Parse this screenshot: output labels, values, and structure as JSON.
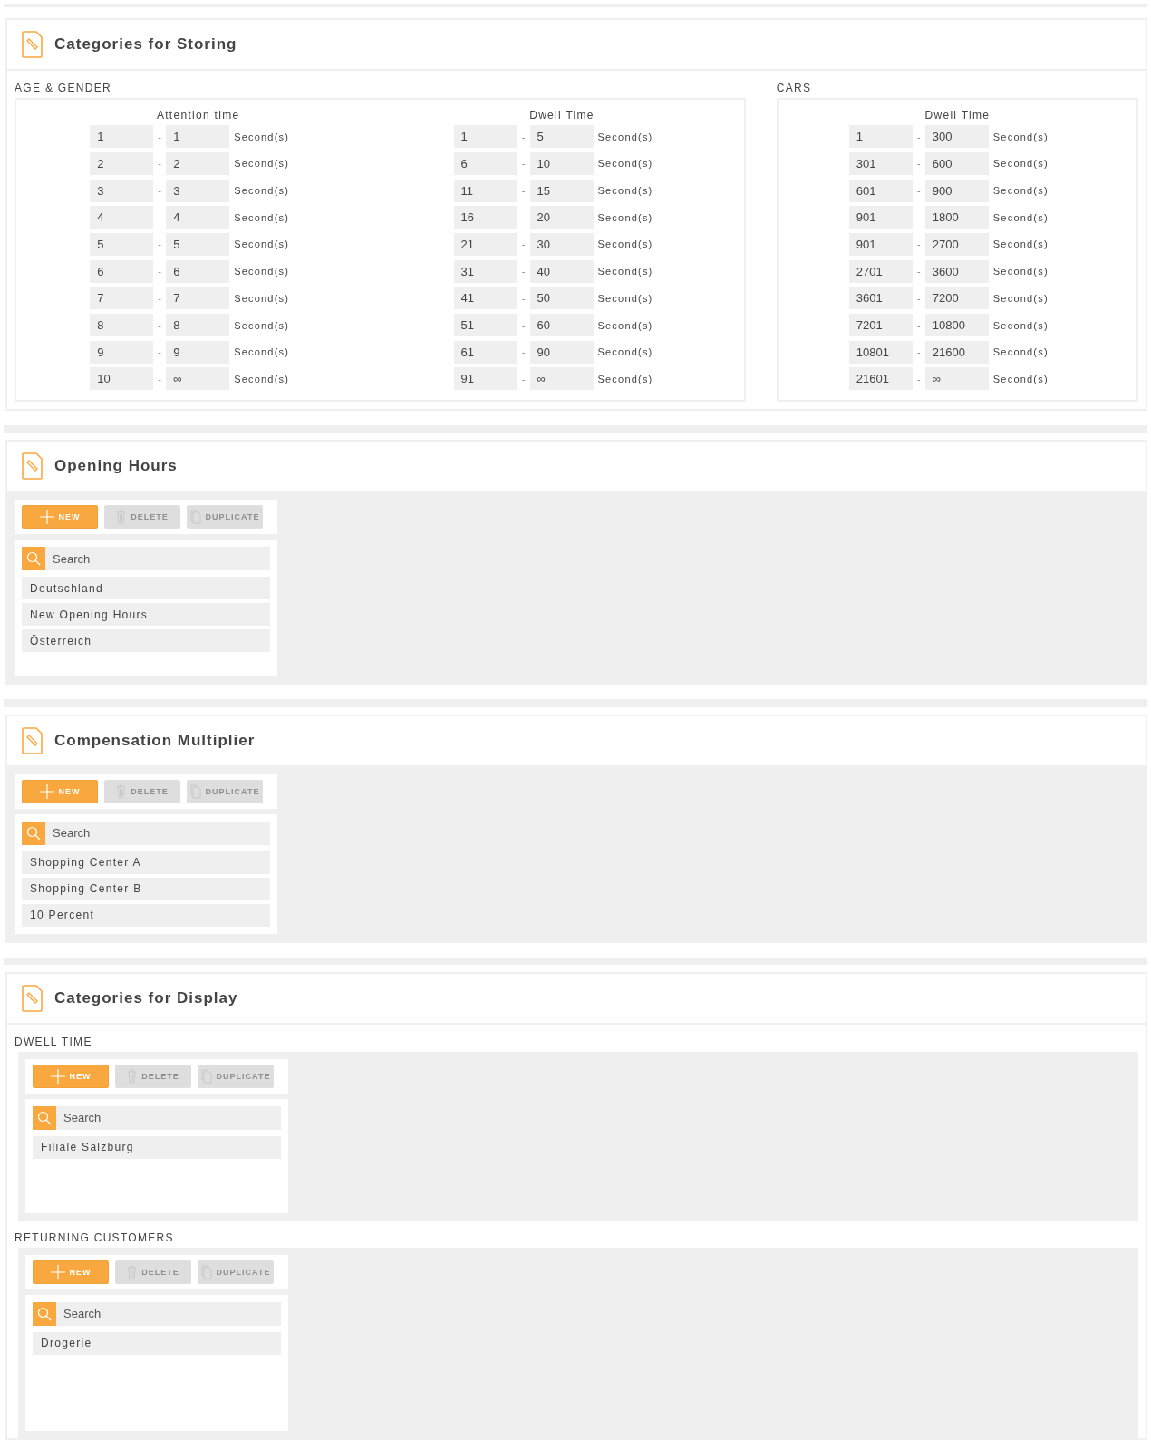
{
  "storing": {
    "title": "Categories for Storing",
    "groups": [
      {
        "label": "AGE & GENDER",
        "tables": [
          {
            "heading": "Attention time",
            "rows": [
              {
                "from": "1",
                "sep": "-",
                "to": "1",
                "unit": "Second(s)"
              },
              {
                "from": "2",
                "sep": "-",
                "to": "2",
                "unit": "Second(s)"
              },
              {
                "from": "3",
                "sep": "-",
                "to": "3",
                "unit": "Second(s)"
              },
              {
                "from": "4",
                "sep": "-",
                "to": "4",
                "unit": "Second(s)"
              },
              {
                "from": "5",
                "sep": "-",
                "to": "5",
                "unit": "Second(s)"
              },
              {
                "from": "6",
                "sep": "-",
                "to": "6",
                "unit": "Second(s)"
              },
              {
                "from": "7",
                "sep": "-",
                "to": "7",
                "unit": "Second(s)"
              },
              {
                "from": "8",
                "sep": "-",
                "to": "8",
                "unit": "Second(s)"
              },
              {
                "from": "9",
                "sep": "-",
                "to": "9",
                "unit": "Second(s)"
              },
              {
                "from": "10",
                "sep": "-",
                "to": "∞",
                "unit": "Second(s)"
              }
            ]
          },
          {
            "heading": "Dwell Time",
            "rows": [
              {
                "from": "1",
                "sep": "-",
                "to": "5",
                "unit": "Second(s)"
              },
              {
                "from": "6",
                "sep": "-",
                "to": "10",
                "unit": "Second(s)"
              },
              {
                "from": "11",
                "sep": "-",
                "to": "15",
                "unit": "Second(s)"
              },
              {
                "from": "16",
                "sep": "-",
                "to": "20",
                "unit": "Second(s)"
              },
              {
                "from": "21",
                "sep": "-",
                "to": "30",
                "unit": "Second(s)"
              },
              {
                "from": "31",
                "sep": "-",
                "to": "40",
                "unit": "Second(s)"
              },
              {
                "from": "41",
                "sep": "-",
                "to": "50",
                "unit": "Second(s)"
              },
              {
                "from": "51",
                "sep": "-",
                "to": "60",
                "unit": "Second(s)"
              },
              {
                "from": "61",
                "sep": "-",
                "to": "90",
                "unit": "Second(s)"
              },
              {
                "from": "91",
                "sep": "-",
                "to": "∞",
                "unit": "Second(s)"
              }
            ]
          }
        ]
      },
      {
        "label": "CARS",
        "tables": [
          {
            "heading": "Dwell Time",
            "rows": [
              {
                "from": "1",
                "sep": "-",
                "to": "300",
                "unit": "Second(s)"
              },
              {
                "from": "301",
                "sep": "-",
                "to": "600",
                "unit": "Second(s)"
              },
              {
                "from": "601",
                "sep": "-",
                "to": "900",
                "unit": "Second(s)"
              },
              {
                "from": "901",
                "sep": "-",
                "to": "1800",
                "unit": "Second(s)"
              },
              {
                "from": "901",
                "sep": "-",
                "to": "2700",
                "unit": "Second(s)"
              },
              {
                "from": "2701",
                "sep": "-",
                "to": "3600",
                "unit": "Second(s)"
              },
              {
                "from": "3601",
                "sep": "-",
                "to": "7200",
                "unit": "Second(s)"
              },
              {
                "from": "7201",
                "sep": "-",
                "to": "10800",
                "unit": "Second(s)"
              },
              {
                "from": "10801",
                "sep": "-",
                "to": "21600",
                "unit": "Second(s)"
              },
              {
                "from": "21601",
                "sep": "-",
                "to": "∞",
                "unit": "Second(s)"
              }
            ]
          }
        ]
      }
    ]
  },
  "list_sections": [
    {
      "title": "Opening Hours",
      "lists": [
        {
          "buttons": [
            {
              "kind": "new",
              "label": "NEW",
              "disabled": false
            },
            {
              "kind": "delete",
              "label": "DELETE",
              "disabled": true
            },
            {
              "kind": "duplicate",
              "label": "DUPLICATE",
              "disabled": true
            }
          ],
          "search": {
            "placeholder": "Search"
          },
          "items": [
            "Deutschland",
            "New Opening Hours",
            "Österreich"
          ]
        }
      ]
    },
    {
      "title": "Compensation Multiplier",
      "lists": [
        {
          "buttons": [
            {
              "kind": "new",
              "label": "NEW",
              "disabled": false
            },
            {
              "kind": "delete",
              "label": "DELETE",
              "disabled": true
            },
            {
              "kind": "duplicate",
              "label": "DUPLICATE",
              "disabled": true
            }
          ],
          "search": {
            "placeholder": "Search"
          },
          "items": [
            "Shopping Center A",
            "Shopping Center B",
            "10 Percent"
          ]
        }
      ]
    },
    {
      "title": "Categories for Display",
      "lists": [
        {
          "label": "DWELL TIME",
          "buttons": [
            {
              "kind": "new",
              "label": "NEW",
              "disabled": false
            },
            {
              "kind": "delete",
              "label": "DELETE",
              "disabled": true
            },
            {
              "kind": "duplicate",
              "label": "DUPLICATE",
              "disabled": true
            }
          ],
          "search": {
            "placeholder": "Search"
          },
          "items": [
            "Filiale Salzburg"
          ]
        },
        {
          "label": "RETURNING CUSTOMERS",
          "buttons": [
            {
              "kind": "new",
              "label": "NEW",
              "disabled": false
            },
            {
              "kind": "delete",
              "label": "DELETE",
              "disabled": true
            },
            {
              "kind": "duplicate",
              "label": "DUPLICATE",
              "disabled": true
            }
          ],
          "search": {
            "placeholder": "Search"
          },
          "items": [
            "Drogerie"
          ]
        }
      ]
    }
  ]
}
